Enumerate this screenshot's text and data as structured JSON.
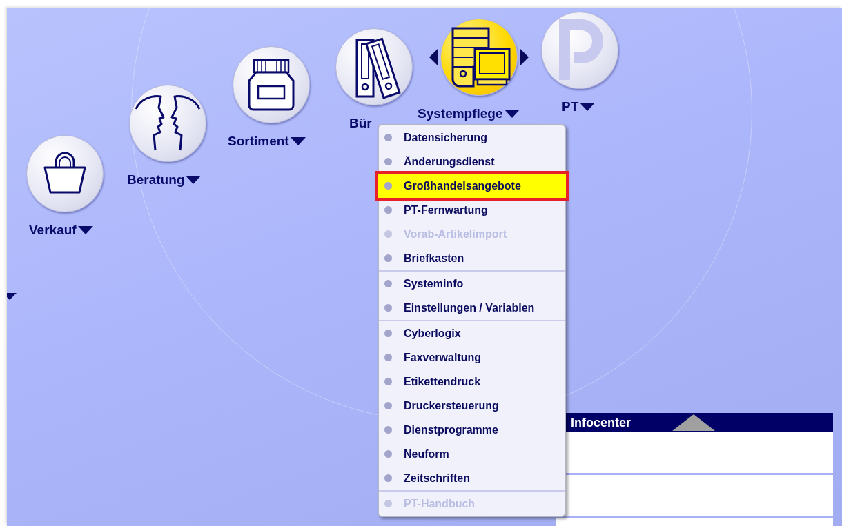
{
  "nav_items": [
    {
      "label": "Verkauf",
      "selected": false,
      "dropdown": true
    },
    {
      "label": "Beratung",
      "selected": false,
      "dropdown": true
    },
    {
      "label": "Sortiment",
      "selected": false,
      "dropdown": true
    },
    {
      "label": "Bür",
      "selected": false,
      "dropdown": false
    },
    {
      "label": "Systempflege",
      "selected": true,
      "dropdown": true
    },
    {
      "label": "PT",
      "selected": false,
      "dropdown": true
    }
  ],
  "menu": {
    "groups": [
      [
        {
          "label": "Datensicherung",
          "selected": false,
          "disabled": false
        },
        {
          "label": "Änderungsdienst",
          "selected": false,
          "disabled": false
        },
        {
          "label": "Großhandelsangebote",
          "selected": true,
          "disabled": false
        },
        {
          "label": "PT-Fernwartung",
          "selected": false,
          "disabled": false
        },
        {
          "label": "Vorab-Artikelimport",
          "selected": false,
          "disabled": true
        },
        {
          "label": "Briefkasten",
          "selected": false,
          "disabled": false
        }
      ],
      [
        {
          "label": "Systeminfo",
          "selected": false,
          "disabled": false
        },
        {
          "label": "Einstellungen / Variablen",
          "selected": false,
          "disabled": false
        }
      ],
      [
        {
          "label": "Cyberlogix",
          "selected": false,
          "disabled": false
        },
        {
          "label": "Faxverwaltung",
          "selected": false,
          "disabled": false
        },
        {
          "label": "Etikettendruck",
          "selected": false,
          "disabled": false
        },
        {
          "label": "Druckersteuerung",
          "selected": false,
          "disabled": false
        },
        {
          "label": "Dienstprogramme",
          "selected": false,
          "disabled": false
        },
        {
          "label": "Neuform",
          "selected": false,
          "disabled": false
        },
        {
          "label": "Zeitschriften",
          "selected": false,
          "disabled": false
        }
      ],
      [
        {
          "label": "PT-Handbuch",
          "selected": false,
          "disabled": true
        }
      ]
    ]
  },
  "infocenter": {
    "title": "Infocenter",
    "expanded": false
  }
}
